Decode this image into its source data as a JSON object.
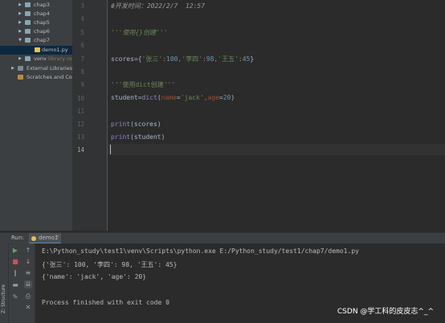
{
  "project_tree": {
    "items": [
      {
        "label": "chap3",
        "icon": "folder-icon",
        "arrow": "▶"
      },
      {
        "label": "chap4",
        "icon": "folder-icon",
        "arrow": "▶"
      },
      {
        "label": "chap5",
        "icon": "folder-icon",
        "arrow": "▶"
      },
      {
        "label": "chap6",
        "icon": "folder-icon",
        "arrow": "▶"
      },
      {
        "label": "chap7",
        "icon": "folder-icon",
        "arrow": "▼"
      },
      {
        "label": "demo1.py",
        "icon": "python-file-icon",
        "arrow": ""
      },
      {
        "label": "venv",
        "sublabel": "library roo",
        "icon": "folder-icon",
        "arrow": "▶"
      },
      {
        "label": "External Libraries",
        "icon": "library-icon",
        "arrow": "▶"
      },
      {
        "label": "Scratches and Con",
        "icon": "scratch-icon",
        "arrow": ""
      }
    ]
  },
  "editor": {
    "line_numbers": [
      "3",
      "4",
      "5",
      "6",
      "7",
      "8",
      "9",
      "10",
      "11",
      "12",
      "13",
      "14"
    ],
    "current_line": "14",
    "line3": "#开发时间：2022/2/7  12:57",
    "line5": "'''使用{}创建'''",
    "line7": {
      "var": "scores",
      "eq": "=",
      "open": "{",
      "k1": "'张三'",
      "c1": ":",
      "v1": "100",
      "s1": ",",
      "k2": "'李四'",
      "c2": ":",
      "v2": "98",
      "s2": ",",
      "k3": "'王五'",
      "c3": ":",
      "v3": "45",
      "close": "}"
    },
    "line9": "'''使用dict创建'''",
    "line10": {
      "var": "student",
      "eq": "=",
      "func": "dict",
      "open": "(",
      "p1": "name",
      "eq1": "=",
      "a1": "'jack'",
      "sep": ",",
      "p2": "age",
      "eq2": "=",
      "a2": "20",
      "close": ")"
    },
    "line12": {
      "func": "print",
      "arg": "(scores)"
    },
    "line13": {
      "func": "print",
      "arg": "(student)"
    }
  },
  "run_panel": {
    "label": "Run:",
    "tab_label": "demo1",
    "tab_close": "×",
    "structure_label": "Z: Structure",
    "console": [
      "E:\\Python_study\\test1\\venv\\Scripts\\python.exe E:/Python_study/test1/chap7/demo1.py",
      "{'张三': 100, '李四': 98, '王五': 45}",
      "{'name': 'jack', 'age': 20}",
      "",
      "Process finished with exit code 0"
    ]
  },
  "watermark": "CSDN @学工科的皮皮志^_^",
  "colors": {
    "background": "#2b2b2b",
    "panel": "#3c3f41",
    "string": "#6a8759",
    "number": "#6897bb",
    "keyword_arg": "#aa4926",
    "builtin": "#8888c6",
    "punctuation": "#cc7832"
  }
}
